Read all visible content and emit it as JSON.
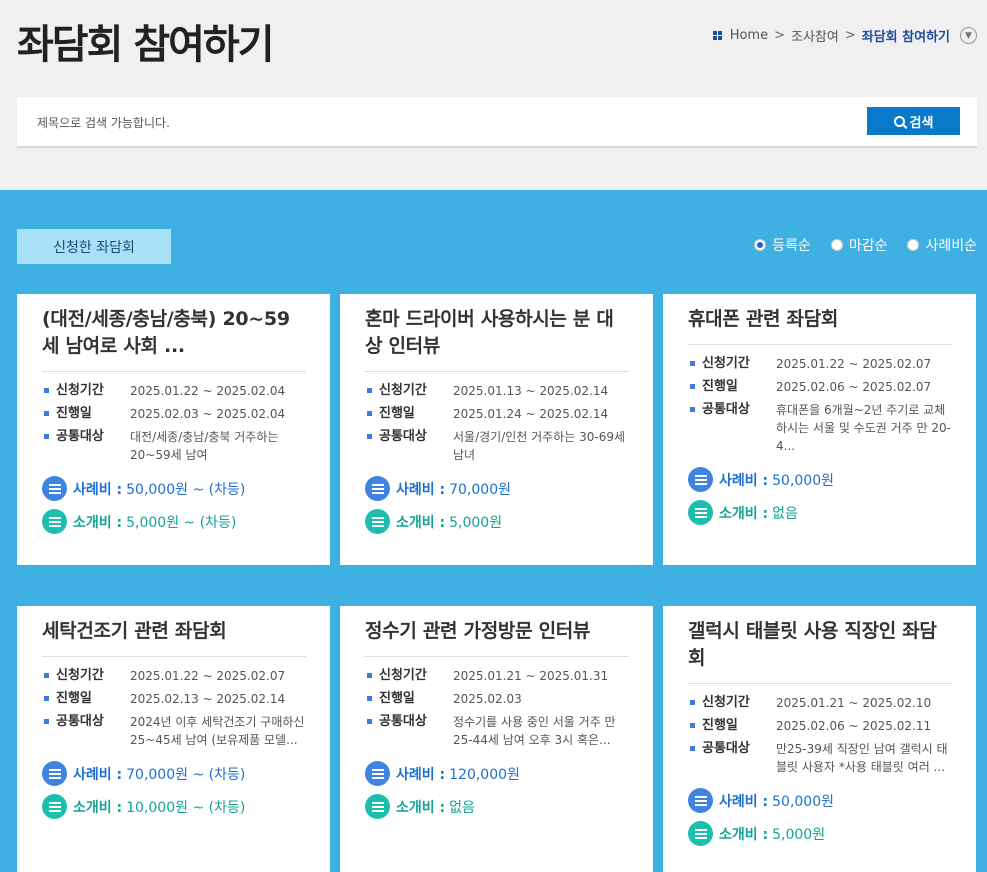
{
  "page": {
    "title": "좌담회 참여하기",
    "breadcrumb": {
      "home": "Home",
      "section": "조사참여",
      "current": "좌담회 참여하기",
      "sep": ">"
    }
  },
  "search": {
    "placeholder": "제목으로 검색 가능합니다.",
    "button_label": "검색"
  },
  "toolbar": {
    "applied_button": "신청한 좌담회",
    "sort_options": [
      {
        "label": "등록순",
        "selected": true
      },
      {
        "label": "마감순",
        "selected": false
      },
      {
        "label": "사례비순",
        "selected": false
      }
    ]
  },
  "labels": {
    "apply_period": "신청기간",
    "progress": "진행일",
    "target": "공통대상",
    "reward": "사례비 :",
    "referral": "소개비 :"
  },
  "cards": [
    {
      "title": "(대전/세종/충남/충북) 20~59세 남여로 사회 ...",
      "apply_period": "2025.01.22 ~ 2025.02.04",
      "progress": "2025.02.03 ~ 2025.02.04",
      "target": "대전/세종/충남/충북 거주하는 20~59세 남여",
      "reward": "50,000원 ~ (차등)",
      "referral": "5,000원 ~ (차등)"
    },
    {
      "title": "혼마 드라이버 사용하시는 분 대상 인터뷰",
      "apply_period": "2025.01.13 ~ 2025.02.14",
      "progress": "2025.01.24 ~ 2025.02.14",
      "target": "서울/경기/인천 거주하는 30-69세 남녀",
      "reward": "70,000원",
      "referral": "5,000원"
    },
    {
      "title": "휴대폰 관련 좌담회",
      "apply_period": "2025.01.22 ~ 2025.02.07",
      "progress": "2025.02.06 ~ 2025.02.07",
      "target": "휴대폰을 6개월~2년 주기로 교체하시는 서울 및 수도권 거주 만 20-4...",
      "reward": "50,000원",
      "referral": "없음"
    },
    {
      "title": "세탁건조기 관련 좌담회",
      "apply_period": "2025.01.22 ~ 2025.02.07",
      "progress": "2025.02.13 ~ 2025.02.14",
      "target": "2024년 이후 세탁건조기 구매하신 25~45세 남여 (보유제품 모델...",
      "reward": "70,000원 ~ (차등)",
      "referral": "10,000원 ~ (차등)"
    },
    {
      "title": "정수기 관련 가정방문 인터뷰",
      "apply_period": "2025.01.21 ~ 2025.01.31",
      "progress": "2025.02.03",
      "target": "정수기를 사용 중인 서울 거주 만 25-44세 남여 오후 3시 혹은...",
      "reward": "120,000원",
      "referral": "없음"
    },
    {
      "title": "갤럭시 태블릿 사용 직장인 좌담회",
      "apply_period": "2025.01.21 ~ 2025.02.10",
      "progress": "2025.02.06 ~ 2025.02.11",
      "target": "만25-39세 직장인 남여 갤럭시 태블릿 사용자 *사용 태블릿 여러 ...",
      "reward": "50,000원",
      "referral": "5,000원"
    }
  ]
}
